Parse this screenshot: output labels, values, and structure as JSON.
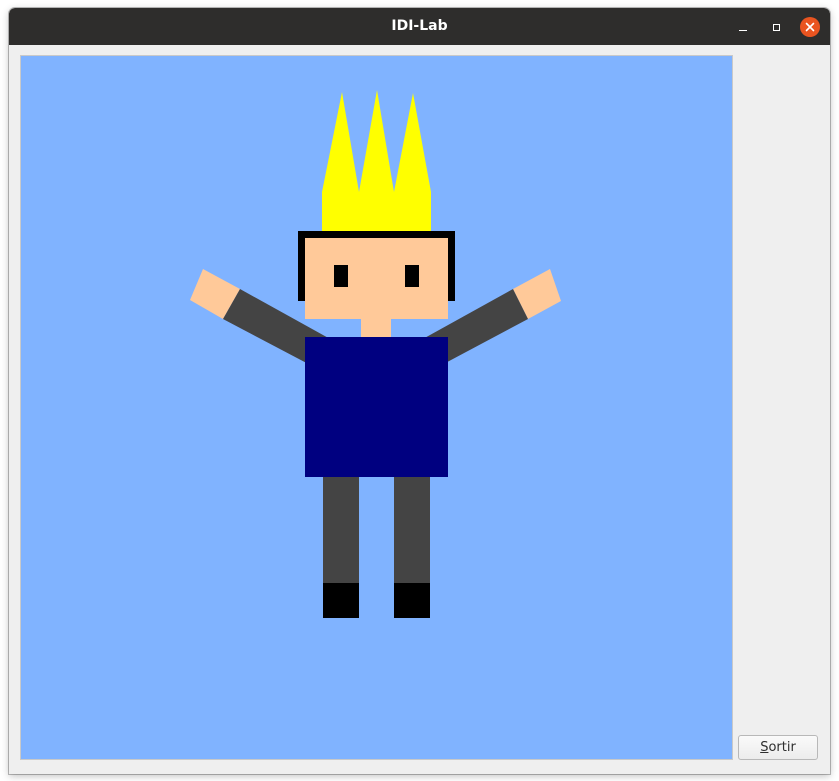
{
  "window": {
    "title": "IDI-Lab"
  },
  "canvas": {
    "background_color": "#80b3ff"
  },
  "figure": {
    "crown_color": "#ffff00",
    "hair_color": "#000000",
    "skin_color": "#ffc999",
    "eye_color": "#000000",
    "shirt_color": "#000080",
    "sleeve_color": "#444444",
    "leg_color": "#444444",
    "shoe_color": "#000000"
  },
  "buttons": {
    "sortir": {
      "mnemonic": "S",
      "rest": "ortir",
      "shortcut_key": "S"
    }
  },
  "icons": {
    "minimize": "minimize-icon",
    "maximize": "maximize-icon",
    "close": "close-icon"
  }
}
